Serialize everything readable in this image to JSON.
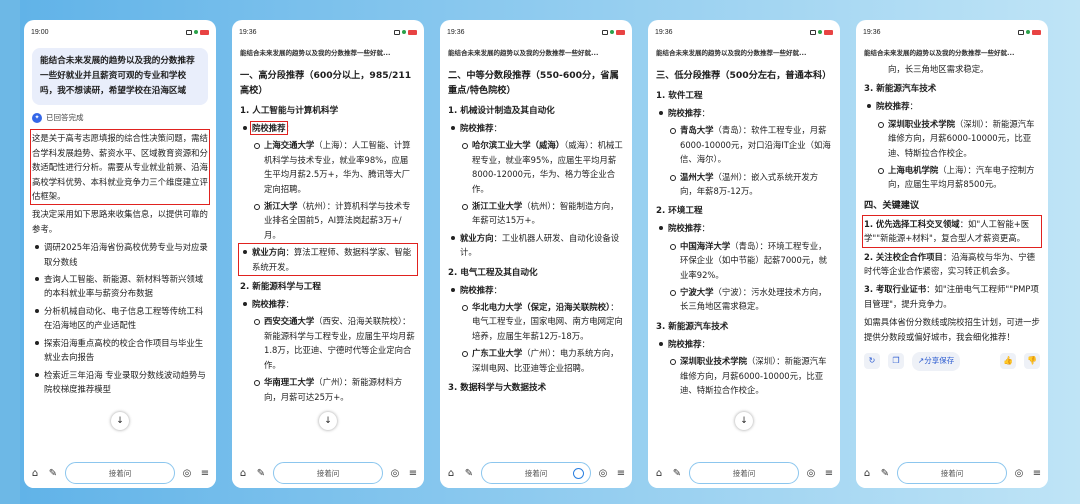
{
  "panels": [
    {
      "time": "19:00",
      "header": "",
      "question": "能结合未来发展的趋势以及我的分数推荐一些好就业并且薪资可观的专业和学校吗，我不想读研，希望学校在沿海区域",
      "done_text": "已回答完成",
      "intro": "这是关于高考志愿填报的综合性决策问题，需结合学科发展趋势、薪资水平、区域教育资源和分数适配性进行分析。需要从专业就业前景、沿海高校学科优势、本科就业竞争力三个维度建立评估框架。",
      "method": "我决定采用如下思路来收集信息，以提供可靠的参考。",
      "bullets": [
        "调研2025年沿海省份高校优势专业与对应录取分数线",
        "查询人工智能、新能源、新材料等新兴领域的本科就业率与薪资分布数据",
        "分析机械自动化、电子信息工程等传统工科在沿海地区的产业适配性",
        "探索沿海重点高校的校企合作项目与毕业生就业去向报告",
        "检索近三年沿海 专业录取分数线波动趋势与院校梯度推荐模型"
      ],
      "input": "接着问"
    },
    {
      "time": "19:36",
      "header": "能结合未来发展的趋势以及我的分数推荐一些好就...",
      "section": "一、高分段推荐（600分以上，985/211高校）",
      "m1": "1. 人工智能与计算机科学",
      "rec": "院校推荐",
      "s1n": "上海交通大学",
      "s1t": "（上海）：人工智能、计算机科学与技术专业，就业率98%，应届生平均月薪2.5万+，华为、腾讯等大厂定向招聘。",
      "s2n": "浙江大学",
      "s2t": "（杭州）：计算机科学与技术专业排名全国前5，AI算法岗起薪3万+/月。",
      "jobk": "就业方向",
      "jobv": "：算法工程师、数据科学家、智能系统开发。",
      "m2": "2. 新能源科学与工程",
      "s3n": "西安交通大学",
      "s3t": "（西安、沿海关联院校）：新能源科学与工程专业，应届生平均月薪1.8万，比亚迪、宁德时代等企业定向合作。",
      "s4n": "华南理工大学",
      "s4t": "（广州）：新能源材料方向，月薪可达25万+。",
      "input": "接着问"
    },
    {
      "time": "19:36",
      "header": "能结合未来发展的趋势以及我的分数推荐一些好就...",
      "section": "二、中等分数段推荐（550-600分，省属重点/特色院校）",
      "m1": "1. 机械设计制造及其自动化",
      "rec": "院校推荐",
      "s1n": "哈尔滨工业大学（威海）",
      "s1t": "（威海）：机械工程专业，就业率95%，应届生平均月薪8000-12000元，华为、格力等企业合作。",
      "s2n": "浙江工业大学",
      "s2t": "（杭州）：智能制造方向，年薪可达15万+。",
      "jobk": "就业方向",
      "jobv": "：工业机器人研发、自动化设备设计。",
      "m2": "2. 电气工程及其自动化",
      "s3n": "华北电力大学（保定，沿海关联院校）",
      "s3t": "：电气工程专业，国家电网、南方电网定向培养，应届生年薪12万-18万。",
      "s4n": "广东工业大学",
      "s4t": "（广州）：电力系统方向，深圳电网、比亚迪等企业招聘。",
      "m3": "3. 数据科学与大数据技术",
      "input": "接着问"
    },
    {
      "time": "19:36",
      "header": "能结合未来发展的趋势以及我的分数推荐一些好就...",
      "section": "三、低分段推荐（500分左右，普通本科）",
      "m1": "1. 软件工程",
      "rec": "院校推荐",
      "s1n": "青岛大学",
      "s1t": "（青岛）：软件工程专业，月薪6000-10000元，对口沿海IT企业（如海信、海尔）。",
      "s2n": "温州大学",
      "s2t": "（温州）：嵌入式系统开发方向，年薪8万-12万。",
      "m2": "2. 环境工程",
      "s3n": "中国海洋大学",
      "s3t": "（青岛）：环境工程专业，环保企业（如中节能）起薪7000元，就业率92%。",
      "s4n": "宁波大学",
      "s4t": "（宁波）：污水处理技术方向，长三角地区需求稳定。",
      "m3": "3. 新能源汽车技术",
      "s5n": "深圳职业技术学院",
      "s5t": "（深圳）：新能源汽车维修方向，月薪6000-10000元，比亚迪、特斯拉合作校企。",
      "input": "接着问"
    },
    {
      "time": "19:36",
      "header": "能结合未来发展的趋势以及我的分数推荐一些好就...",
      "top": "向，长三角地区需求稳定。",
      "m3": "3. 新能源汽车技术",
      "rec": "院校推荐",
      "s1n": "深圳职业技术学院",
      "s1t": "（深圳）：新能源汽车维修方向，月薪6000-10000元，比亚迪、特斯拉合作校企。",
      "s2n": "上海电机学院",
      "s2t": "（上海）：汽车电子控制方向，应届生平均月薪8500元。",
      "section": "四、关键建议",
      "k1n": "1. 优先选择工科交叉领域",
      "k1t": "：如\"人工智能+医学\"\"新能源+材料\"，复合型人才薪资更高。",
      "k2n": "2. 关注校企合作项目",
      "k2t": "：沿海高校与华为、宁德时代等企业合作紧密，实习转正机会多。",
      "k3n": "3. 考取行业证书",
      "k3t": "：如\"注册电气工程师\"\"PMP项目管理\"，提升竞争力。",
      "closing": "如需具体省份分数线或院校招生计划，可进一步提供分数段或偏好城市，我会细化推荐！",
      "share": "分享保存",
      "input": "接着问"
    }
  ]
}
